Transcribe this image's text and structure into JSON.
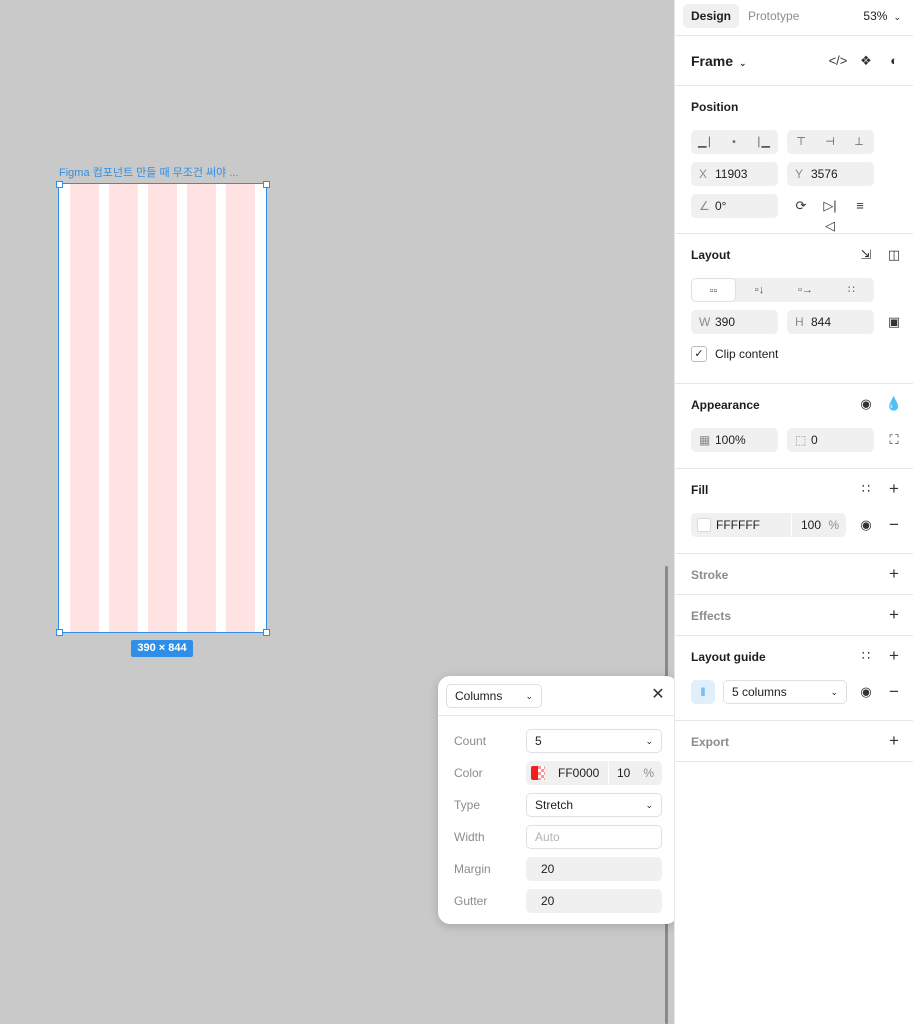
{
  "canvas": {
    "frame_label": "Figma 컴포넌트 만들 때 무조건 써야 ...",
    "size_badge": "390 × 844",
    "columns_visible": 5,
    "column_color": "#ffe3e3",
    "selection_color": "#2f8fe8"
  },
  "popover": {
    "type_select": "Columns",
    "close_icon": "close-icon",
    "rows": {
      "count_label": "Count",
      "count_value": "5",
      "color_label": "Color",
      "color_hex": "FF0000",
      "color_opacity": "10",
      "color_pct": "%",
      "type_label": "Type",
      "type_value": "Stretch",
      "width_label": "Width",
      "width_placeholder": "Auto",
      "margin_label": "Margin",
      "margin_value": "20",
      "gutter_label": "Gutter",
      "gutter_value": "20"
    }
  },
  "panel": {
    "tabs": {
      "design": "Design",
      "prototype": "Prototype"
    },
    "zoom": "53%",
    "frame_title": "Frame",
    "position": {
      "title": "Position",
      "x_label": "X",
      "x_value": "11903",
      "y_label": "Y",
      "y_value": "3576",
      "rotation": "0°"
    },
    "layout": {
      "title": "Layout",
      "w_label": "W",
      "w_value": "390",
      "h_label": "H",
      "h_value": "844",
      "clip_label": "Clip content"
    },
    "appearance": {
      "title": "Appearance",
      "opacity": "100%",
      "radius": "0"
    },
    "fill": {
      "title": "Fill",
      "hex": "FFFFFF",
      "opacity": "100",
      "pct": "%"
    },
    "stroke": {
      "title": "Stroke"
    },
    "effects": {
      "title": "Effects"
    },
    "layout_guide": {
      "title": "Layout guide",
      "value": "5 columns"
    },
    "export": {
      "title": "Export"
    }
  }
}
